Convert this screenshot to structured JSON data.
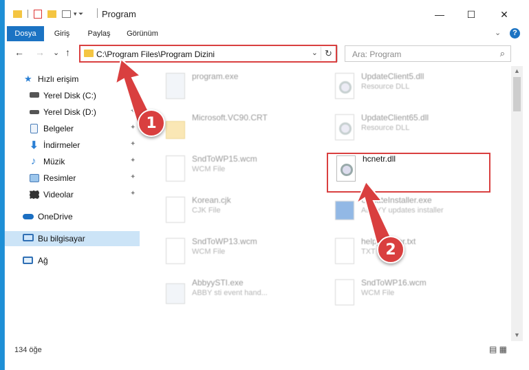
{
  "window": {
    "title": "Program",
    "controls": {
      "minimize": "—",
      "maximize": "☐",
      "close": "✕"
    }
  },
  "ribbon": {
    "tabs": [
      "Dosya",
      "Giriş",
      "Paylaş",
      "Görünüm"
    ],
    "active_tab": "Dosya",
    "expand_glyph": "⌄",
    "help_glyph": "?"
  },
  "navigation": {
    "back": "←",
    "forward": "→",
    "recent": "⌄",
    "up": "↑",
    "address": "C:\\Program Files\\Program Dizini",
    "address_dropdown": "⌄",
    "refresh": "↻",
    "search_placeholder": "Ara: Program",
    "search_icon": "⌕"
  },
  "sidebar": {
    "items": [
      {
        "label": "Hızlı erişim",
        "icon": "star-icon",
        "pinned": false
      },
      {
        "label": "Yerel Disk (C:)",
        "icon": "drive-icon",
        "pinned": true
      },
      {
        "label": "Yerel Disk (D:)",
        "icon": "drive-icon",
        "pinned": true
      },
      {
        "label": "Belgeler",
        "icon": "documents-icon",
        "pinned": true
      },
      {
        "label": "İndirmeler",
        "icon": "download-icon",
        "pinned": true
      },
      {
        "label": "Müzik",
        "icon": "music-icon",
        "pinned": true
      },
      {
        "label": "Resimler",
        "icon": "pictures-icon",
        "pinned": true
      },
      {
        "label": "Videolar",
        "icon": "videos-icon",
        "pinned": true
      },
      {
        "label": "OneDrive",
        "icon": "cloud-icon",
        "pinned": false
      },
      {
        "label": "Bu bilgisayar",
        "icon": "computer-icon",
        "pinned": false,
        "selected": true
      },
      {
        "label": "Ağ",
        "icon": "network-icon",
        "pinned": false
      }
    ],
    "pin_glyph": "📌"
  },
  "files": [
    {
      "name": "program.exe",
      "desc": "",
      "icon": "exe-icon"
    },
    {
      "name": "UpdateClient5.dll",
      "desc": "Resource DLL",
      "icon": "dll-icon"
    },
    {
      "name": "Microsoft.VC90.CRT",
      "desc": "",
      "icon": "folder-icon"
    },
    {
      "name": "UpdateClient65.dll",
      "desc": "Resource DLL",
      "icon": "dll-icon"
    },
    {
      "name": "SndToWP15.wcm",
      "desc": "WCM File",
      "icon": "file-icon"
    },
    {
      "name": "hcnetr.dll",
      "desc": "",
      "icon": "dll-icon",
      "highlighted": true
    },
    {
      "name": "Korean.cjk",
      "desc": "CJK File",
      "icon": "file-icon"
    },
    {
      "name": "UpdateInstaller.exe",
      "desc": "ABBYY updates installer",
      "icon": "exe-icon"
    },
    {
      "name": "SndToWP13.wcm",
      "desc": "WCM File",
      "icon": "file-icon"
    },
    {
      "name": "help_reader.txt",
      "desc": "TXT File",
      "icon": "file-icon"
    },
    {
      "name": "AbbyySTI.exe",
      "desc": "ABBY sti event hand...",
      "icon": "exe-icon"
    },
    {
      "name": "SndToWP16.wcm",
      "desc": "WCM File",
      "icon": "file-icon"
    }
  ],
  "status": {
    "item_count": "134 öğe"
  },
  "annotations": {
    "step1": "1",
    "step2": "2",
    "color": "#d93f3f"
  }
}
